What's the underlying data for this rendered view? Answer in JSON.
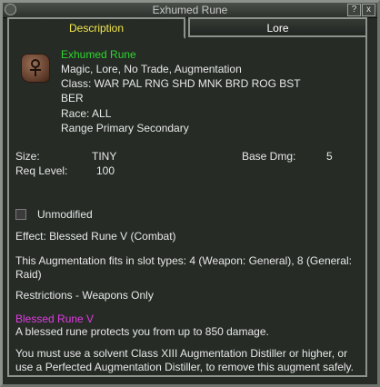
{
  "window": {
    "title": "Exhumed Rune",
    "help_label": "?",
    "close_label": "x"
  },
  "tabs": [
    {
      "label": "Description",
      "active": true
    },
    {
      "label": "Lore",
      "active": false
    }
  ],
  "item": {
    "icon": "rune-stone-icon",
    "name": "Exhumed Rune",
    "flags": "Magic, Lore, No Trade, Augmentation",
    "class_line1": "Class: WAR PAL RNG SHD MNK BRD ROG BST",
    "class_line2": "BER",
    "race": "Race: ALL",
    "slots": "Range Primary Secondary"
  },
  "stats": {
    "size_label": "Size:",
    "size_value": "TINY",
    "req_level_label": "Req Level:",
    "req_level_value": "100",
    "base_dmg_label": "Base Dmg:",
    "base_dmg_value": "5"
  },
  "unmodified_label": "Unmodified",
  "effect": "Effect: Blessed Rune V (Combat)",
  "augment_fit_line1": "This Augmentation fits in slot types: 4 (Weapon: General), 8 (General:",
  "augment_fit_line2": "Raid)",
  "restrictions": "Restrictions - Weapons Only",
  "spell": {
    "name": "Blessed Rune V",
    "description": "A blessed rune protects you from up to 850 damage."
  },
  "removal_line1": "You must use a solvent Class XIII Augmentation Distiller or higher, or",
  "removal_line2": "use a Perfected Augmentation Distiller, to remove this augment safely.",
  "colors": {
    "item_name": "#2ed62e",
    "spell_name": "#e03ce0",
    "active_tab": "#f2e84a",
    "text": "#e8e8e8",
    "background": "#262b26"
  }
}
